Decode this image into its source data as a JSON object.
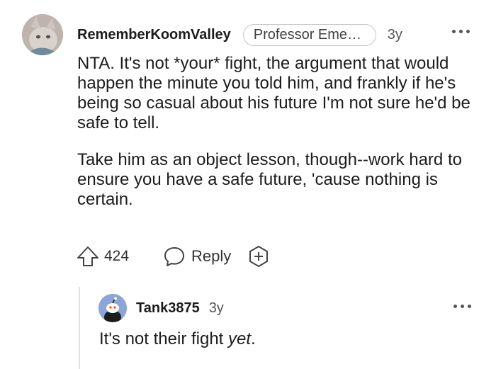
{
  "comment": {
    "username": "RememberKoomValley",
    "flair": "Professor Emeri...",
    "age": "3y",
    "paragraphs": [
      "NTA. It's not *your* fight, the argument that would happen the minute you told him, and frankly if he's being so casual about his future I'm not sure he'd be safe to tell.",
      "Take him as an object lesson, though--work hard to ensure you have a safe future, 'cause nothing is certain."
    ],
    "score": "424",
    "reply_label": "Reply",
    "icons": {
      "avatar": "cat-photo-avatar",
      "more": "more-options-icon",
      "upvote": "upvote-arrow-icon",
      "reply": "speech-bubble-icon",
      "award": "award-plus-icon"
    }
  },
  "reply": {
    "username": "Tank3875",
    "age": "3y",
    "body_prefix": "It's not their fight ",
    "body_emphasis": "yet",
    "body_suffix": ".",
    "icons": {
      "avatar": "default-snoo-avatar",
      "more": "more-options-icon"
    }
  },
  "colors": {
    "text": "#1c1c1c",
    "muted": "#555555",
    "flair_border": "#c7c7c7",
    "thread_line": "#e0e0e0",
    "reply_avatar_bg": "#8aa5d6"
  }
}
